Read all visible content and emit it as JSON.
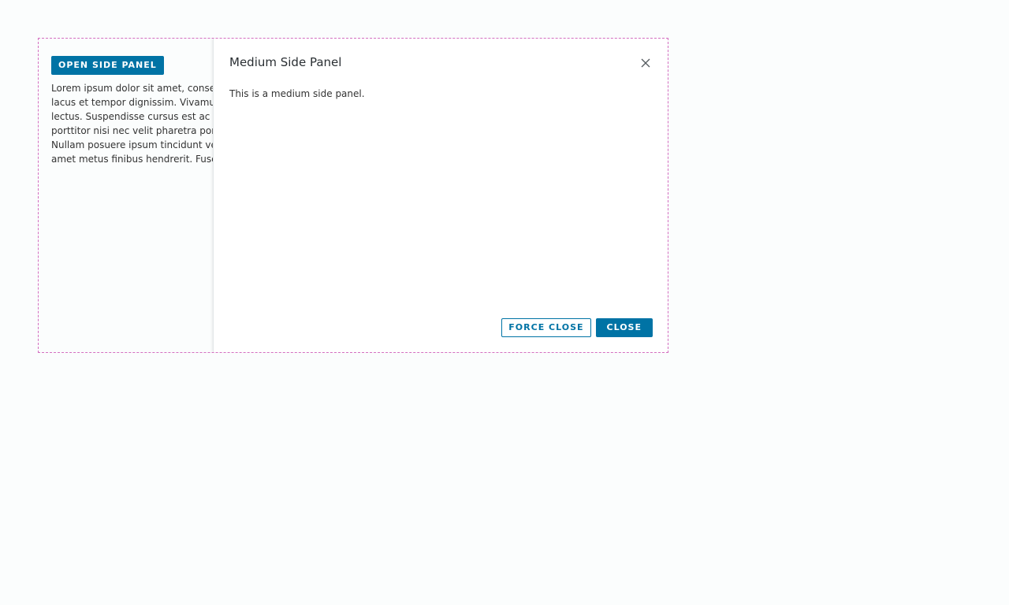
{
  "main": {
    "open_button_label": "OPEN SIDE PANEL",
    "paragraph_lines": [
      "Lorem ipsum dolor sit amet, consectetur adipiscing elit. Sed lobortis, felis vitae",
      "lacus et tempor dignissim. Vivamus vehicula nisl sit amet ante ultrices, ac aliquam",
      "lectus. Suspendisse cursus est ac nulla placerat, a dignissim nunc maximus. Etiam",
      "porttitor nisi nec velit pharetra porttitor. Cras ac turpis sed eros pellentesque.",
      "Nullam posuere ipsum tincidunt velit rhoncus, vel tristique magna congue. Morbi sit",
      "amet metus finibus hendrerit. Fusce at lorem vel nisi feugiat vestibulum."
    ]
  },
  "side_panel": {
    "title": "Medium Side Panel",
    "body": "This is a medium side panel.",
    "close_icon": "close-icon",
    "force_close_label": "FORCE CLOSE",
    "close_label": "CLOSE"
  },
  "colors": {
    "primary": "#0073a5",
    "stage_border": "#d46ec0"
  }
}
